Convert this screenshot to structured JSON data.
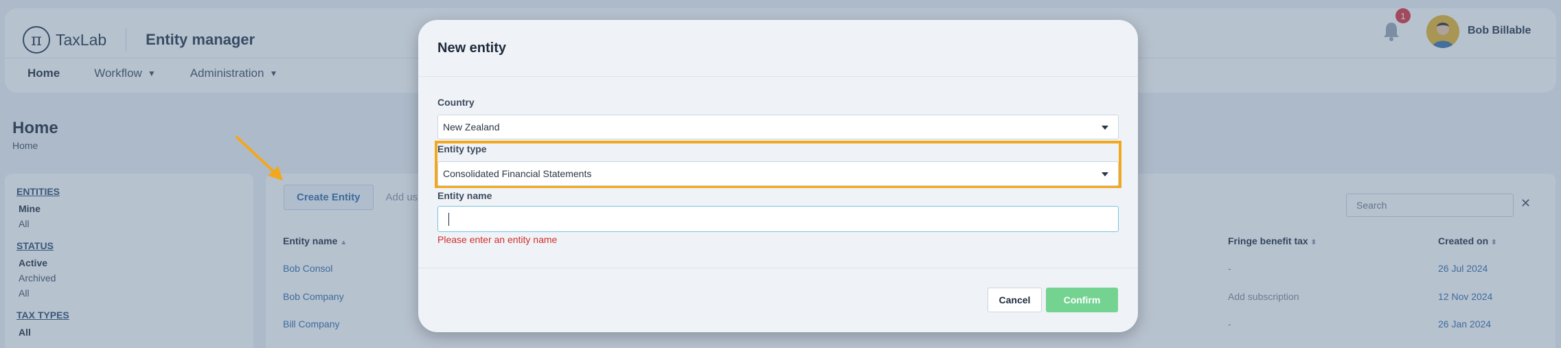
{
  "header": {
    "brand": "TaxLab",
    "brand_logo": "π",
    "app_title": "Entity manager",
    "notification_count": "1",
    "user_name": "Bob Billable"
  },
  "nav": {
    "home": "Home",
    "workflow": "Workflow",
    "administration": "Administration"
  },
  "page": {
    "title": "Home",
    "breadcrumb": "Home"
  },
  "sidebar": {
    "entities_heading": "ENTITIES",
    "entities_mine": "Mine",
    "entities_all": "All",
    "status_heading": "STATUS",
    "status_active": "Active",
    "status_archived": "Archived",
    "status_all": "All",
    "tax_types_heading": "TAX TYPES",
    "tax_types_all": "All"
  },
  "toolbar": {
    "create_entity": "Create Entity",
    "add_user": "Add use",
    "search_placeholder": "Search",
    "clear": "✕"
  },
  "table": {
    "headers": {
      "entity_name": "Entity name",
      "fringe_benefit_tax": "Fringe benefit tax",
      "created_on": "Created on"
    },
    "rows": [
      {
        "entity_name": "Bob Consol",
        "fringe_benefit_tax": "-",
        "created_on": "26 Jul 2024"
      },
      {
        "entity_name": "Bob Company",
        "fringe_benefit_tax": "Add subscription",
        "created_on": "12 Nov 2024"
      },
      {
        "entity_name": "Bill Company",
        "fringe_benefit_tax": "-",
        "created_on": "26 Jan 2024"
      }
    ]
  },
  "modal": {
    "title": "New entity",
    "country_label": "Country",
    "country_value": "New Zealand",
    "entity_type_label": "Entity type",
    "entity_type_value": "Consolidated Financial Statements",
    "entity_name_label": "Entity name",
    "entity_name_value": "",
    "entity_name_error": "Please enter an entity name",
    "cancel": "Cancel",
    "confirm": "Confirm"
  },
  "colors": {
    "highlight": "#f2a81d",
    "confirm_button": "#74d391",
    "error": "#d32c2c",
    "link": "#2e6aa6",
    "badge": "#d9303c"
  }
}
